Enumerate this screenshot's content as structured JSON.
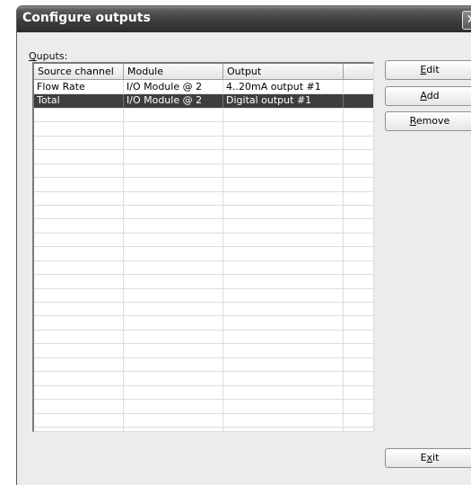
{
  "window": {
    "title": "Configure outputs",
    "close_glyph": "✕"
  },
  "outputs": {
    "group_label_mnemonic": "Q",
    "group_label_rest": "uputs:",
    "columns": [
      "Source channel",
      "Module",
      "Output",
      ""
    ],
    "rows": [
      {
        "source": "Flow Rate",
        "module": "I/O Module @ 2",
        "output": "4..20mA output #1",
        "selected": false
      },
      {
        "source": "Total",
        "module": "I/O Module @ 2",
        "output": "Digital output #1",
        "selected": true
      }
    ],
    "empty_row_count": 24
  },
  "buttons": {
    "edit": {
      "mnemonic": "E",
      "rest": "dit"
    },
    "add": {
      "mnemonic": "A",
      "rest": "dd"
    },
    "remove": {
      "mnemonic": "R",
      "rest": "emove"
    },
    "exit": {
      "pre": "E",
      "mnemonic": "x",
      "rest": "it"
    }
  },
  "colors": {
    "selection": "#3e3e3e",
    "titlebar": "#3d3d3d"
  }
}
